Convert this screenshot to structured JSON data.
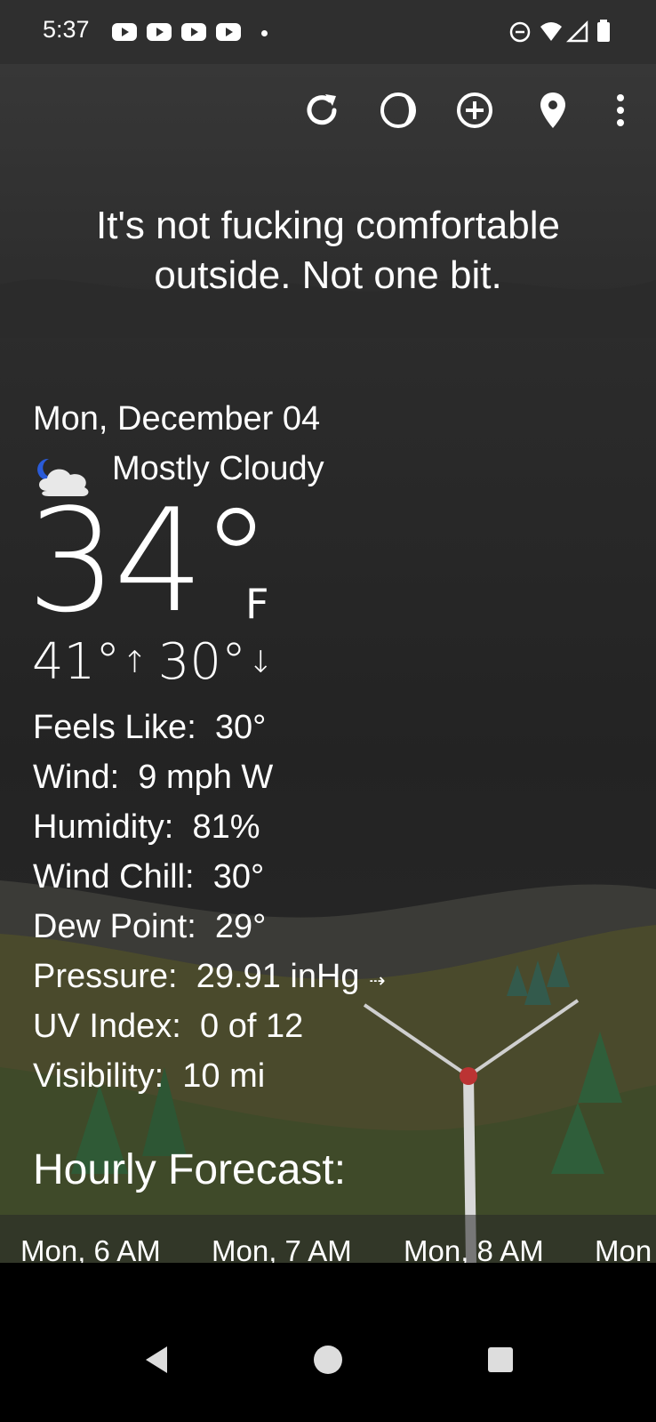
{
  "status_bar": {
    "time": "5:37"
  },
  "toolbar": {
    "icons": [
      "refresh-icon",
      "moon-phase-icon",
      "add-location-icon",
      "location-pin-icon",
      "more-vert-icon"
    ]
  },
  "quote": "It's not fucking comfortable outside. Not one bit.",
  "current": {
    "date": "Mon, December 04",
    "condition": "Mostly Cloudy",
    "temperature": "34°",
    "unit": "F",
    "high": "41°",
    "low": "30°"
  },
  "details": [
    {
      "label": "Feels Like:",
      "value": "30°"
    },
    {
      "label": "Wind:",
      "value": "9 mph W"
    },
    {
      "label": "Humidity:",
      "value": "81%"
    },
    {
      "label": "Wind Chill:",
      "value": "30°"
    },
    {
      "label": "Dew Point:",
      "value": "29°"
    },
    {
      "label": "Pressure:",
      "value": "29.91 inHg"
    },
    {
      "label": "UV Index:",
      "value": "0 of 12"
    },
    {
      "label": "Visibility:",
      "value": "10 mi"
    }
  ],
  "hourly": {
    "title": "Hourly Forecast:",
    "items": [
      "Mon, 6 AM",
      "Mon, 7 AM",
      "Mon, 8 AM",
      "Mon"
    ]
  },
  "colors": {
    "sky_top": "#3a3a3a",
    "sky_mid": "#252525",
    "hill": "#4b4a2a",
    "tree": "#2f5e3a"
  }
}
